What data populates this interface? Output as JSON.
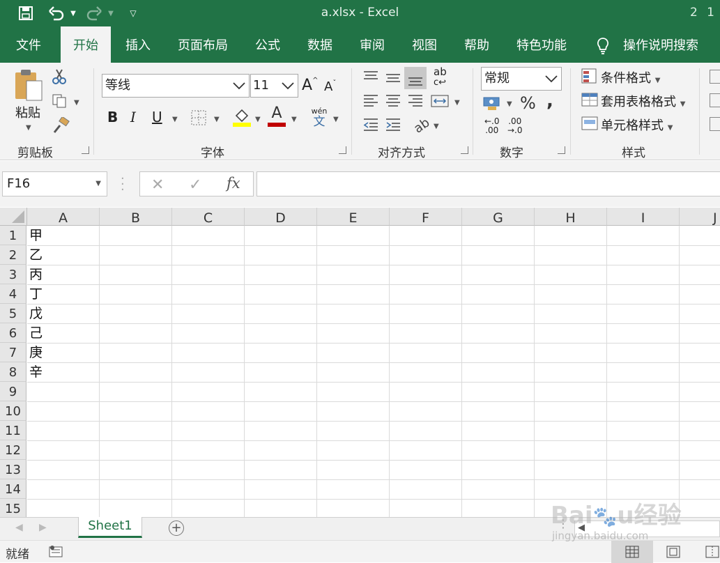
{
  "titlebar": {
    "title": "a.xlsx - Excel",
    "user_initials": "2 1"
  },
  "tabs": [
    "文件",
    "开始",
    "插入",
    "页面布局",
    "公式",
    "数据",
    "审阅",
    "视图",
    "帮助",
    "特色功能"
  ],
  "tell_me": "操作说明搜索",
  "ribbon": {
    "clipboard": {
      "paste_label": "粘贴",
      "group_label": "剪贴板"
    },
    "font": {
      "font_name": "等线",
      "font_size": "11",
      "group_label": "字体",
      "bold": "B",
      "italic": "I",
      "underline": "U",
      "font_color_glyph": "A",
      "phonetic_top": "wén",
      "phonetic_bottom": "文"
    },
    "alignment": {
      "group_label": "对齐方式",
      "wrap_glyph": "ab"
    },
    "number": {
      "format": "常规",
      "group_label": "数字",
      "percent": "%",
      "comma": ",",
      "inc_decimal_top": "←.0",
      "inc_decimal_bottom": ".00",
      "dec_decimal_top": ".00",
      "dec_decimal_bottom": "→.0"
    },
    "styles": {
      "conditional": "条件格式",
      "table_format": "套用表格格式",
      "cell_styles": "单元格样式",
      "group_label": "样式"
    }
  },
  "formula_bar": {
    "name_box": "F16",
    "fx": "fx",
    "formula": ""
  },
  "sheet": {
    "columns": [
      "A",
      "B",
      "C",
      "D",
      "E",
      "F",
      "G",
      "H",
      "I",
      "J"
    ],
    "rows": [
      "1",
      "2",
      "3",
      "4",
      "5",
      "6",
      "7",
      "8",
      "9",
      "10",
      "11",
      "12",
      "13",
      "14",
      "15"
    ],
    "col_a_values": [
      "甲",
      "乙",
      "丙",
      "丁",
      "戊",
      "己",
      "庚",
      "辛"
    ]
  },
  "sheet_tabs": {
    "active": "Sheet1"
  },
  "status": {
    "text": "就绪"
  },
  "watermark": "Baidu经验 jingyan.baidu.com",
  "colors": {
    "excel_green": "#217346",
    "ribbon_bg": "#f3f3f3",
    "header_bg": "#e6e6e6",
    "highlight_yellow": "#ffff00",
    "font_red": "#c00000"
  }
}
